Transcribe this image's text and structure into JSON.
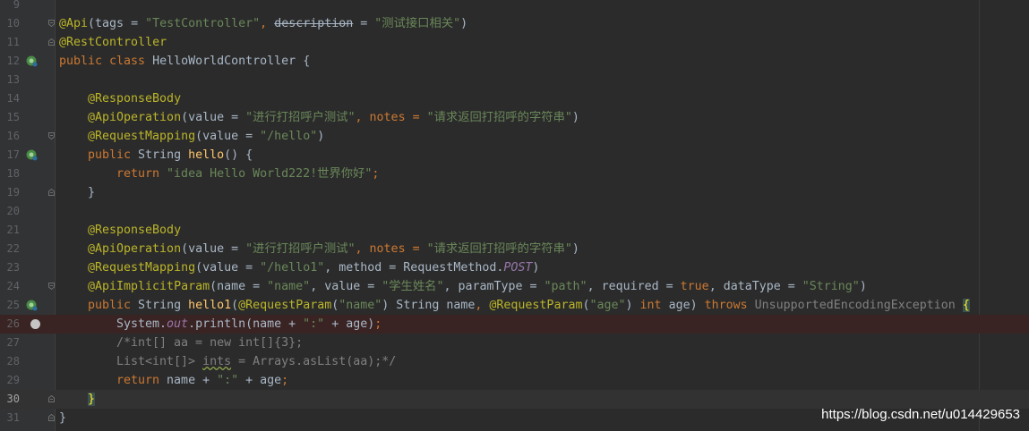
{
  "editor": {
    "lines": [
      {
        "num": "9"
      },
      {
        "num": "10",
        "t": {
          "a": "@Api",
          "p1": "(tags = ",
          "s1": "\"TestController\"",
          "p2": ", ",
          "strike": "description",
          "p3": " = ",
          "s2": "\"测试接口相关\"",
          "p4": ")"
        }
      },
      {
        "num": "11",
        "t": {
          "a": "@RestController"
        }
      },
      {
        "num": "12",
        "t": {
          "k": "public class ",
          "p": "HelloWorldController {"
        }
      },
      {
        "num": "13"
      },
      {
        "num": "14",
        "t": {
          "a": "@ResponseBody"
        }
      },
      {
        "num": "15",
        "t": {
          "a": "@ApiOperation",
          "p1": "(value = ",
          "s1": "\"进行打招呼户测试\"",
          "p2": ", notes = ",
          "s2": "\"请求返回打招呼的字符串\"",
          "p3": ")"
        }
      },
      {
        "num": "16",
        "t": {
          "a": "@RequestMapping",
          "p1": "(value = ",
          "s1": "\"/hello\"",
          "p2": ")"
        }
      },
      {
        "num": "17",
        "t": {
          "k": "public ",
          "p1": "String ",
          "f": "hello",
          "p2": "() {"
        }
      },
      {
        "num": "18",
        "t": {
          "k": "return ",
          "s": "\"idea Hello World222!世界你好\"",
          "k2": ";"
        }
      },
      {
        "num": "19",
        "t": {
          "p": "}"
        }
      },
      {
        "num": "20"
      },
      {
        "num": "21",
        "t": {
          "a": "@ResponseBody"
        }
      },
      {
        "num": "22",
        "t": {
          "a": "@ApiOperation",
          "p1": "(value = ",
          "s1": "\"进行打招呼户测试\"",
          "p2": ", notes = ",
          "s2": "\"请求返回打招呼的字符串\"",
          "p3": ")"
        }
      },
      {
        "num": "23",
        "t": {
          "a": "@RequestMapping",
          "p1": "(value = ",
          "s1": "\"/hello1\"",
          "p2": ", method = RequestMethod.",
          "st": "POST",
          "p3": ")"
        }
      },
      {
        "num": "24",
        "t": {
          "a": "@ApiImplicitParam",
          "p1": "(name = ",
          "s1": "\"name\"",
          "p2": ", value = ",
          "s2": "\"学生姓名\"",
          "p3": ", paramType = ",
          "s3": "\"path\"",
          "p4": ", required = ",
          "k1": "true",
          "p5": ", dataType = ",
          "s4": "\"String\"",
          "p6": ")"
        }
      },
      {
        "num": "25",
        "t": {
          "k1": "public ",
          "p1": "String ",
          "f": "hello1",
          "p2": "(",
          "a1": "@RequestParam",
          "p3": "(",
          "s1": "\"name\"",
          "p4": ") String name",
          "k2": ", ",
          "a2": "@RequestParam",
          "p5": "(",
          "s2": "\"age\"",
          "p6": ") ",
          "k3": "int ",
          "p7": "age) ",
          "k4": "throws ",
          "g": "UnsupportedEncodingException ",
          "b": "{"
        }
      },
      {
        "num": "26",
        "t": {
          "p1": "System.",
          "st": "out",
          "p2": ".println(name + ",
          "s": "\":\"",
          "p3": " + age)",
          "k": ";"
        }
      },
      {
        "num": "27",
        "t": {
          "c": "/*int[] aa = new int[]{3};"
        }
      },
      {
        "num": "28",
        "t": {
          "c1": "List<int[]> ",
          "cu": "ints",
          "c2": " = Arrays.asList(aa);*/"
        }
      },
      {
        "num": "29",
        "t": {
          "k": "return ",
          "p1": "name + ",
          "s": "\":\"",
          "p2": " + age",
          "k2": ";"
        }
      },
      {
        "num": "30",
        "t": {
          "b": "}"
        }
      },
      {
        "num": "31",
        "t": {
          "p": "}"
        }
      }
    ]
  },
  "icons": {
    "bean": "spring-bean-gutter-icon",
    "breakpoint": "breakpoint-icon",
    "fold": "fold-marker-icon"
  },
  "colors": {
    "background": "#2b2b2b",
    "annotation": "#bbb529",
    "keyword": "#cc7832",
    "string": "#6a8759",
    "comment": "#808080",
    "method": "#ffc66d",
    "static_field": "#9876aa",
    "text": "#a9b7c6"
  },
  "watermark": "https://blog.csdn.net/u014429653"
}
